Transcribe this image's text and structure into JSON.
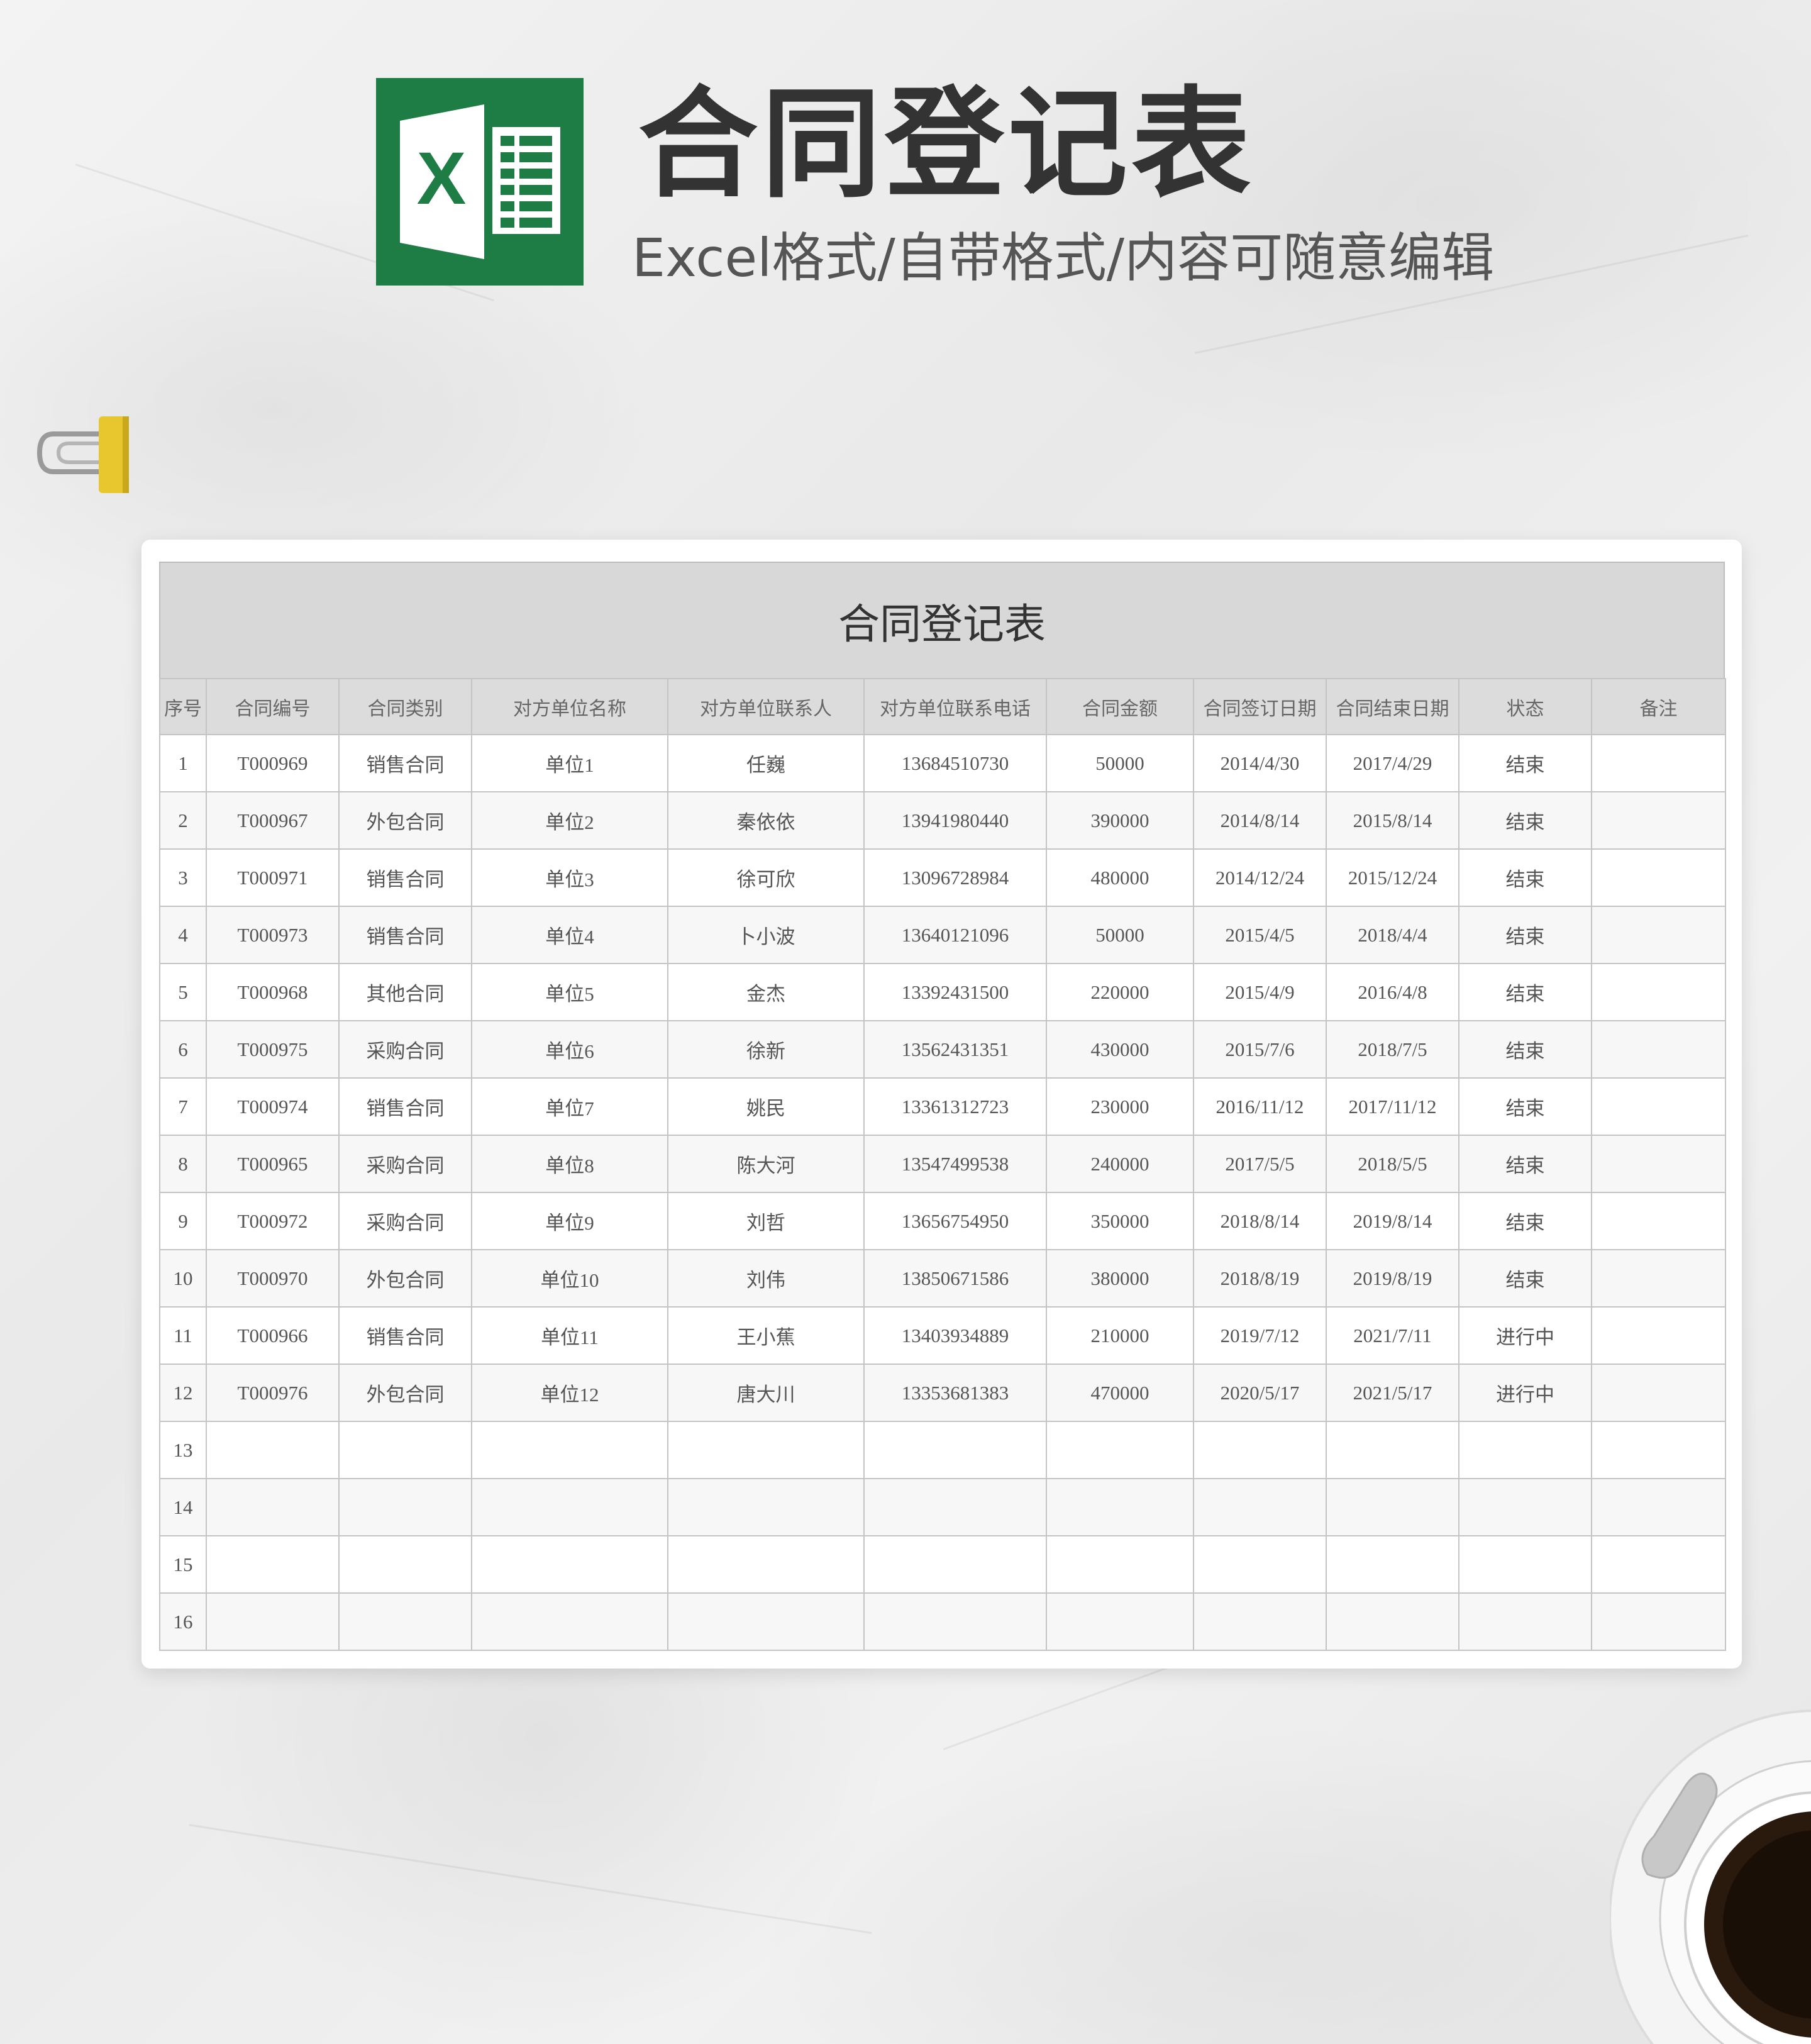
{
  "header": {
    "title": "合同登记表",
    "subtitle": "Excel格式/自带格式/内容可随意编辑",
    "logo_letter": "X",
    "brand_color": "#1e7c45"
  },
  "sheet": {
    "title": "合同登记表",
    "columns": [
      "序号",
      "合同编号",
      "合同类别",
      "对方单位名称",
      "对方单位联系人",
      "对方单位联系电话",
      "合同金额",
      "合同签订日期",
      "合同结束日期",
      "状态",
      "备注"
    ],
    "rows": [
      [
        "1",
        "T000969",
        "销售合同",
        "单位1",
        "任巍",
        "13684510730",
        "50000",
        "2014/4/30",
        "2017/4/29",
        "结束",
        ""
      ],
      [
        "2",
        "T000967",
        "外包合同",
        "单位2",
        "秦依依",
        "13941980440",
        "390000",
        "2014/8/14",
        "2015/8/14",
        "结束",
        ""
      ],
      [
        "3",
        "T000971",
        "销售合同",
        "单位3",
        "徐可欣",
        "13096728984",
        "480000",
        "2014/12/24",
        "2015/12/24",
        "结束",
        ""
      ],
      [
        "4",
        "T000973",
        "销售合同",
        "单位4",
        "卜小波",
        "13640121096",
        "50000",
        "2015/4/5",
        "2018/4/4",
        "结束",
        ""
      ],
      [
        "5",
        "T000968",
        "其他合同",
        "单位5",
        "金杰",
        "13392431500",
        "220000",
        "2015/4/9",
        "2016/4/8",
        "结束",
        ""
      ],
      [
        "6",
        "T000975",
        "采购合同",
        "单位6",
        "徐新",
        "13562431351",
        "430000",
        "2015/7/6",
        "2018/7/5",
        "结束",
        ""
      ],
      [
        "7",
        "T000974",
        "销售合同",
        "单位7",
        "姚民",
        "13361312723",
        "230000",
        "2016/11/12",
        "2017/11/12",
        "结束",
        ""
      ],
      [
        "8",
        "T000965",
        "采购合同",
        "单位8",
        "陈大河",
        "13547499538",
        "240000",
        "2017/5/5",
        "2018/5/5",
        "结束",
        ""
      ],
      [
        "9",
        "T000972",
        "采购合同",
        "单位9",
        "刘哲",
        "13656754950",
        "350000",
        "2018/8/14",
        "2019/8/14",
        "结束",
        ""
      ],
      [
        "10",
        "T000970",
        "外包合同",
        "单位10",
        "刘伟",
        "13850671586",
        "380000",
        "2018/8/19",
        "2019/8/19",
        "结束",
        ""
      ],
      [
        "11",
        "T000966",
        "销售合同",
        "单位11",
        "王小蕉",
        "13403934889",
        "210000",
        "2019/7/12",
        "2021/7/11",
        "进行中",
        ""
      ],
      [
        "12",
        "T000976",
        "外包合同",
        "单位12",
        "唐大川",
        "13353681383",
        "470000",
        "2020/5/17",
        "2021/5/17",
        "进行中",
        ""
      ],
      [
        "13",
        "",
        "",
        "",
        "",
        "",
        "",
        "",
        "",
        "",
        ""
      ],
      [
        "14",
        "",
        "",
        "",
        "",
        "",
        "",
        "",
        "",
        "",
        ""
      ],
      [
        "15",
        "",
        "",
        "",
        "",
        "",
        "",
        "",
        "",
        "",
        ""
      ],
      [
        "16",
        "",
        "",
        "",
        "",
        "",
        "",
        "",
        "",
        "",
        ""
      ]
    ]
  }
}
